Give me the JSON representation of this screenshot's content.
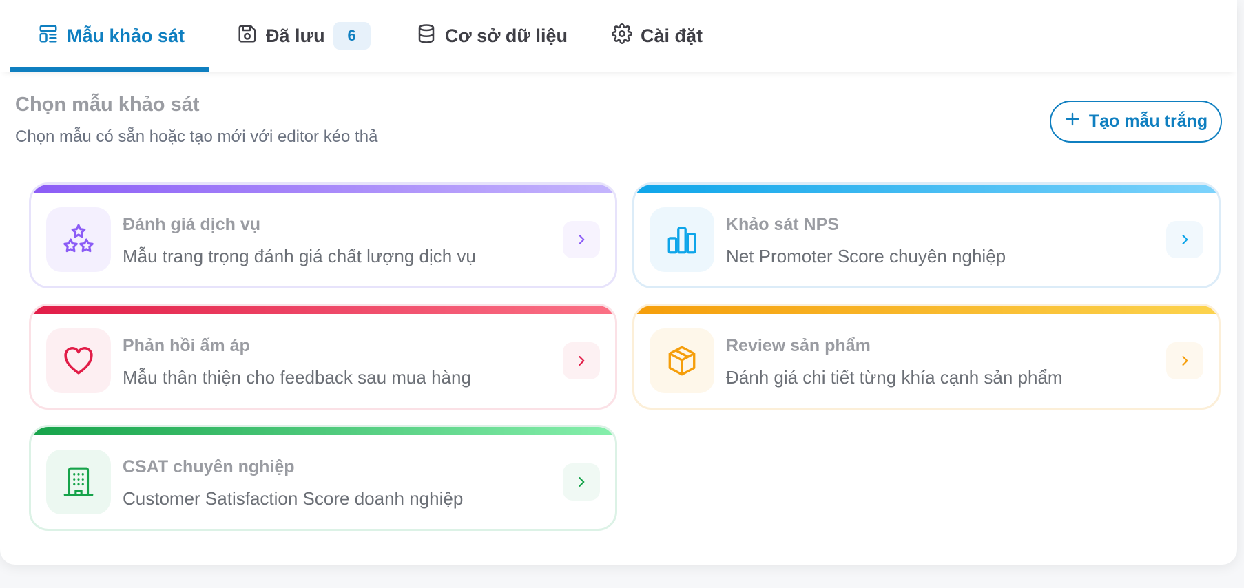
{
  "tabs": [
    {
      "label": "Mẫu khảo sát",
      "icon": "template-icon",
      "active": true
    },
    {
      "label": "Đã lưu",
      "icon": "save-icon",
      "badge": "6"
    },
    {
      "label": "Cơ sở dữ liệu",
      "icon": "database-icon"
    },
    {
      "label": "Cài đặt",
      "icon": "gear-icon"
    }
  ],
  "header": {
    "title": "Chọn mẫu khảo sát",
    "subtitle": "Chọn mẫu có sẵn hoặc tạo mới với editor kéo thả",
    "create_button": "Tạo mẫu trắng"
  },
  "templates": [
    {
      "title": "Đánh giá dịch vụ",
      "description": "Mẫu trang trọng đánh giá chất lượng dịch vụ",
      "icon": "stars-icon",
      "color": "#8b5cf6"
    },
    {
      "title": "Khảo sát NPS",
      "description": "Net Promoter Score chuyên nghiệp",
      "icon": "bar-chart-icon",
      "color": "#0ea5e9"
    },
    {
      "title": "Phản hồi ấm áp",
      "description": "Mẫu thân thiện cho feedback sau mua hàng",
      "icon": "heart-icon",
      "color": "#e11d48"
    },
    {
      "title": "Review sản phẩm",
      "description": "Đánh giá chi tiết từng khía cạnh sản phẩm",
      "icon": "package-icon",
      "color": "#f59e0b"
    },
    {
      "title": "CSAT chuyên nghiệp",
      "description": "Customer Satisfaction Score doanh nghiệp",
      "icon": "building-icon",
      "color": "#16a34a"
    }
  ]
}
